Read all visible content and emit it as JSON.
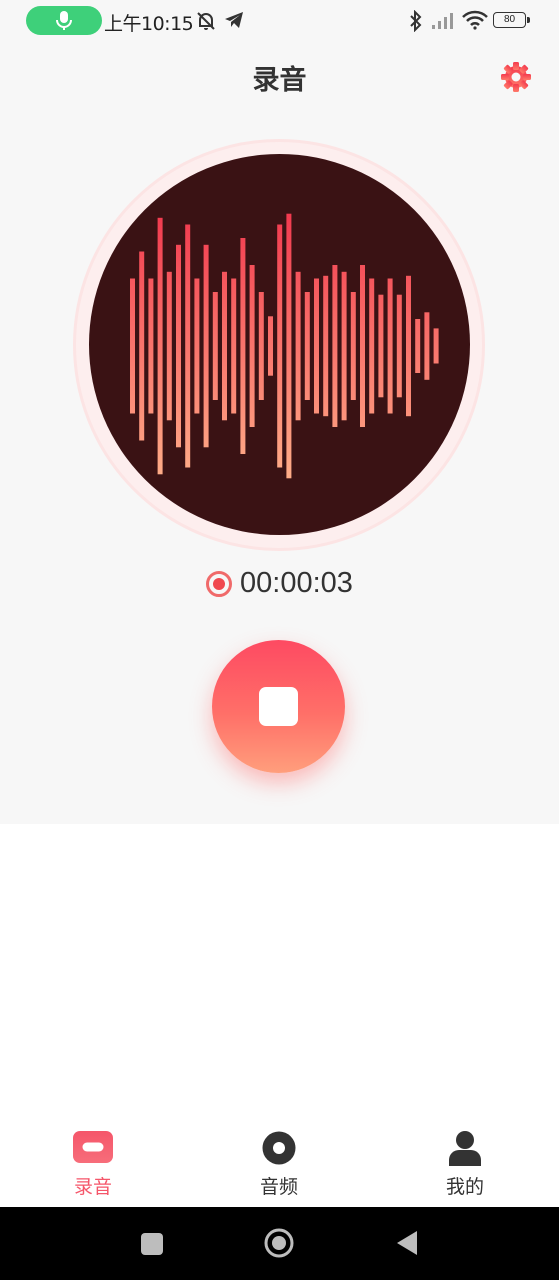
{
  "status_bar": {
    "time": "上午10:15",
    "battery": "80",
    "icons": [
      "mic-icon",
      "mute-bell-icon",
      "telegram-icon",
      "bluetooth-icon",
      "signal-icon",
      "wifi-icon",
      "battery-icon"
    ]
  },
  "header": {
    "title": "录音",
    "settings_icon": "gear-icon"
  },
  "recorder": {
    "waveform_levels": [
      0.5,
      0.7,
      0.5,
      0.95,
      0.55,
      0.75,
      0.9,
      0.5,
      0.75,
      0.4,
      0.55,
      0.5,
      0.8,
      0.6,
      0.4,
      0.22,
      0.9,
      0.98,
      0.55,
      0.4,
      0.5,
      0.52,
      0.6,
      0.55,
      0.4,
      0.6,
      0.5,
      0.38,
      0.5,
      0.38,
      0.52,
      0.2,
      0.25,
      0.13
    ],
    "timer": "00:00:03",
    "stop_button_icon": "stop-icon"
  },
  "bottom_nav": {
    "items": [
      {
        "label": "录音",
        "icon": "record-icon",
        "active": true
      },
      {
        "label": "音频",
        "icon": "audio-disc-icon",
        "active": false
      },
      {
        "label": "我的",
        "icon": "person-icon",
        "active": false
      }
    ]
  },
  "colors": {
    "accent": "#f5566a",
    "disc_background": "#3a1214",
    "wave_top": "#f23a4f",
    "wave_bottom": "#ffb08a"
  }
}
